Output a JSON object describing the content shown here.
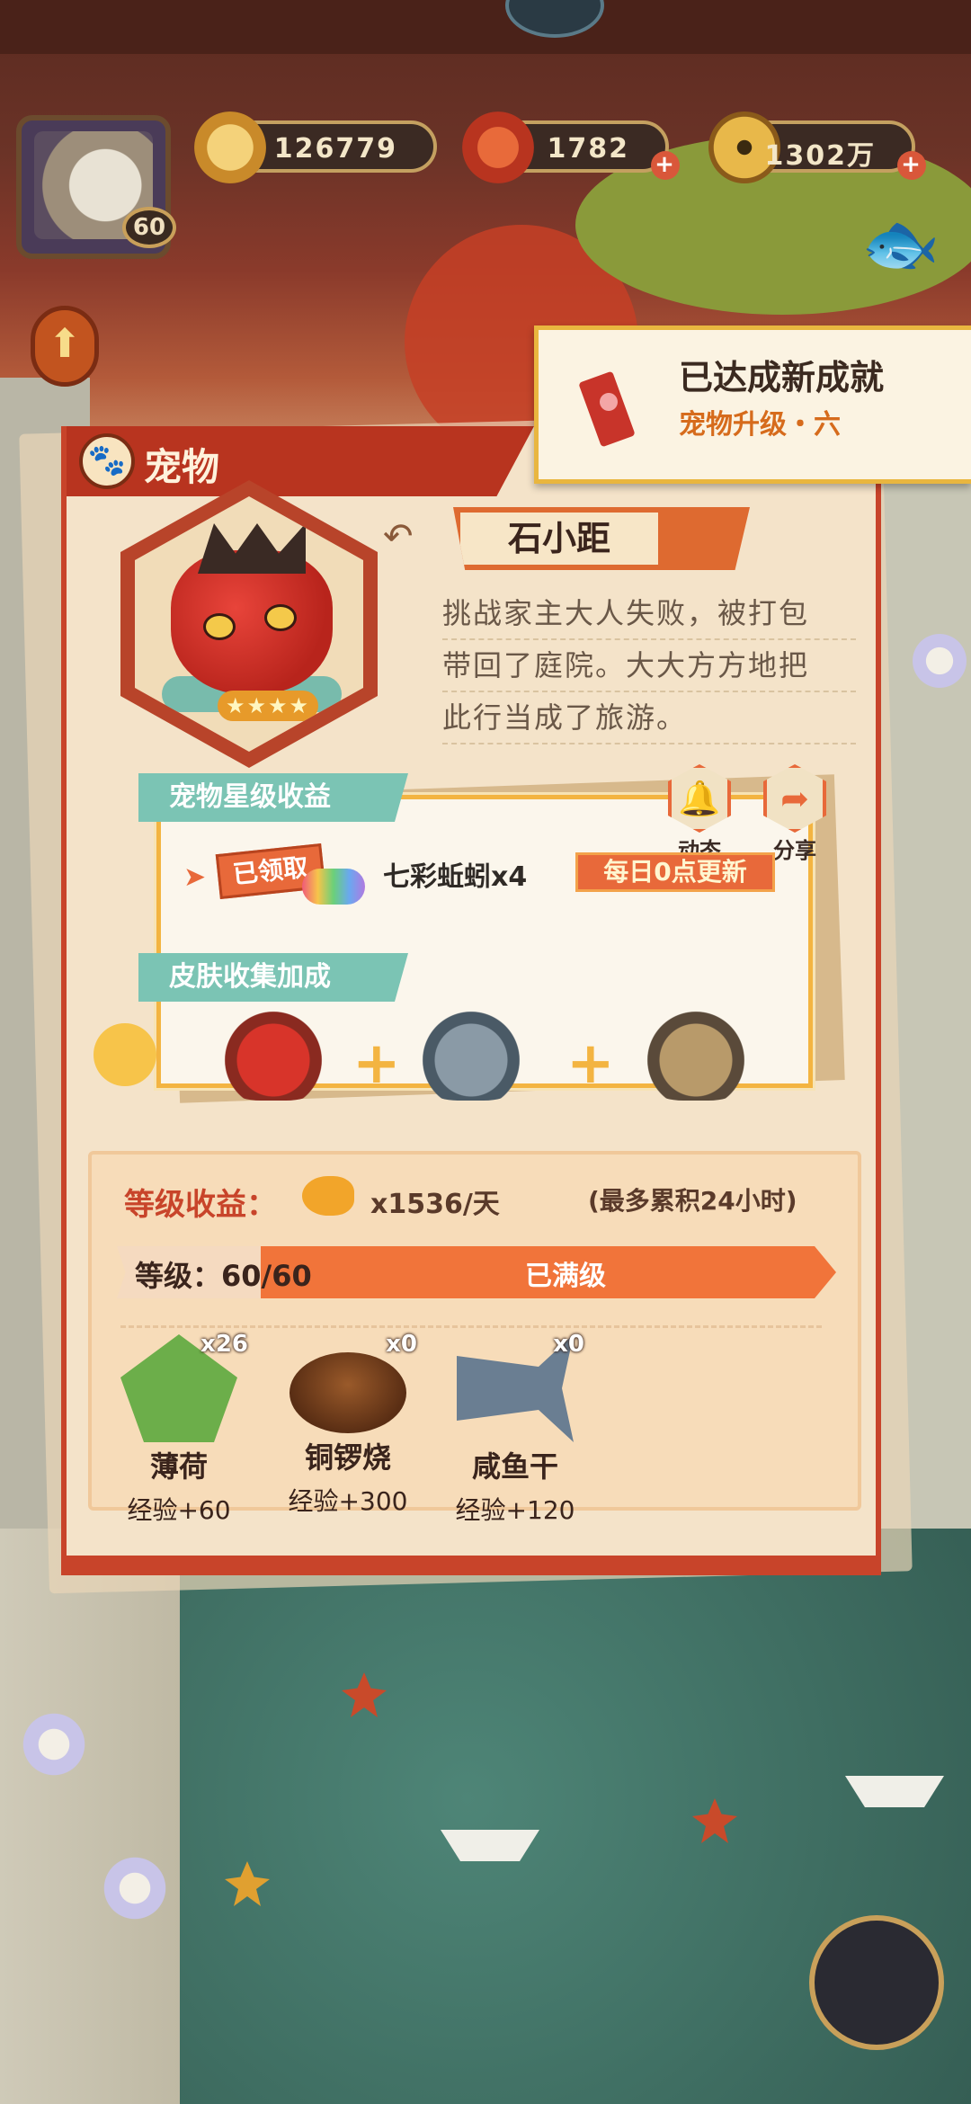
{
  "resources": {
    "level": "60",
    "gold_rings": "126779",
    "magatama": "1782",
    "coins": "1302万"
  },
  "toast": {
    "title": "已达成新成就",
    "subtitle": "宠物升级・六"
  },
  "panel": {
    "title": "宠物",
    "pet_name": "石小距",
    "description_lines": [
      "挑战家主大人失败，被打包",
      "带回了庭院。大大方方地把",
      "此行当成了旅游。"
    ],
    "star_benefit_tab": "宠物星级收益",
    "claimed_label": "已领取",
    "reward": "七彩蚯蚓x4",
    "daily_update": "每日0点更新",
    "dynamic_label": "动态",
    "share_label": "分享",
    "skin_tab": "皮肤收集加成",
    "level_income_label": "等级收益：",
    "level_income_value": "x1536/天",
    "level_income_note": "(最多累积24小时)",
    "level_label": "等级：60/60",
    "level_max_label": "已满级",
    "level_progress": 1.0,
    "items": [
      {
        "name": "薄荷",
        "count": "x26",
        "exp": "经验+60"
      },
      {
        "name": "铜锣烧",
        "count": "x0",
        "exp": "经验+300"
      },
      {
        "name": "咸鱼干",
        "count": "x0",
        "exp": "经验+120"
      }
    ]
  }
}
